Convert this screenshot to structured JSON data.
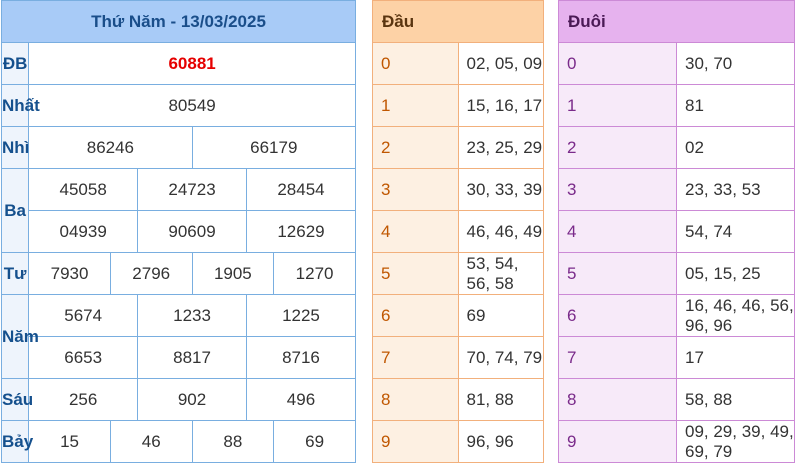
{
  "header": {
    "title": "Thứ Năm - 13/03/2025"
  },
  "prizes": {
    "db": {
      "label": "ĐB",
      "values": [
        "60881"
      ]
    },
    "nhat": {
      "label": "Nhất",
      "values": [
        "80549"
      ]
    },
    "nhi": {
      "label": "Nhì",
      "values": [
        "86246",
        "66179"
      ]
    },
    "ba": {
      "label": "Ba",
      "values": [
        "45058",
        "24723",
        "28454",
        "04939",
        "90609",
        "12629"
      ]
    },
    "tu": {
      "label": "Tư",
      "values": [
        "7930",
        "2796",
        "1905",
        "1270"
      ]
    },
    "nam": {
      "label": "Năm",
      "values": [
        "5674",
        "1233",
        "1225",
        "6653",
        "8817",
        "8716"
      ]
    },
    "sau": {
      "label": "Sáu",
      "values": [
        "256",
        "902",
        "496"
      ]
    },
    "bay": {
      "label": "Bảy",
      "values": [
        "15",
        "46",
        "88",
        "69"
      ]
    }
  },
  "dau": {
    "title": "Đầu",
    "rows": [
      {
        "k": "0",
        "v": "02, 05, 09"
      },
      {
        "k": "1",
        "v": "15, 16, 17"
      },
      {
        "k": "2",
        "v": "23, 25, 29"
      },
      {
        "k": "3",
        "v": "30, 33, 39"
      },
      {
        "k": "4",
        "v": "46, 46, 49"
      },
      {
        "k": "5",
        "v": "53, 54, 56, 58"
      },
      {
        "k": "6",
        "v": "69"
      },
      {
        "k": "7",
        "v": "70, 74, 79"
      },
      {
        "k": "8",
        "v": "81, 88"
      },
      {
        "k": "9",
        "v": "96, 96"
      }
    ]
  },
  "duoi": {
    "title": "Đuôi",
    "rows": [
      {
        "k": "0",
        "v": "30, 70"
      },
      {
        "k": "1",
        "v": "81"
      },
      {
        "k": "2",
        "v": "02"
      },
      {
        "k": "3",
        "v": "23, 33, 53"
      },
      {
        "k": "4",
        "v": "54, 74"
      },
      {
        "k": "5",
        "v": "05, 15, 25"
      },
      {
        "k": "6",
        "v": "16, 46, 46, 56, 96, 96"
      },
      {
        "k": "7",
        "v": "17"
      },
      {
        "k": "8",
        "v": "58, 88"
      },
      {
        "k": "9",
        "v": "09, 29, 39, 49, 69, 79"
      }
    ]
  },
  "colors": {
    "results_header": "#a8cbf7",
    "special_prize": "#e60000",
    "dau_header": "#fdd2a6",
    "duoi_header": "#e6b2ee"
  }
}
